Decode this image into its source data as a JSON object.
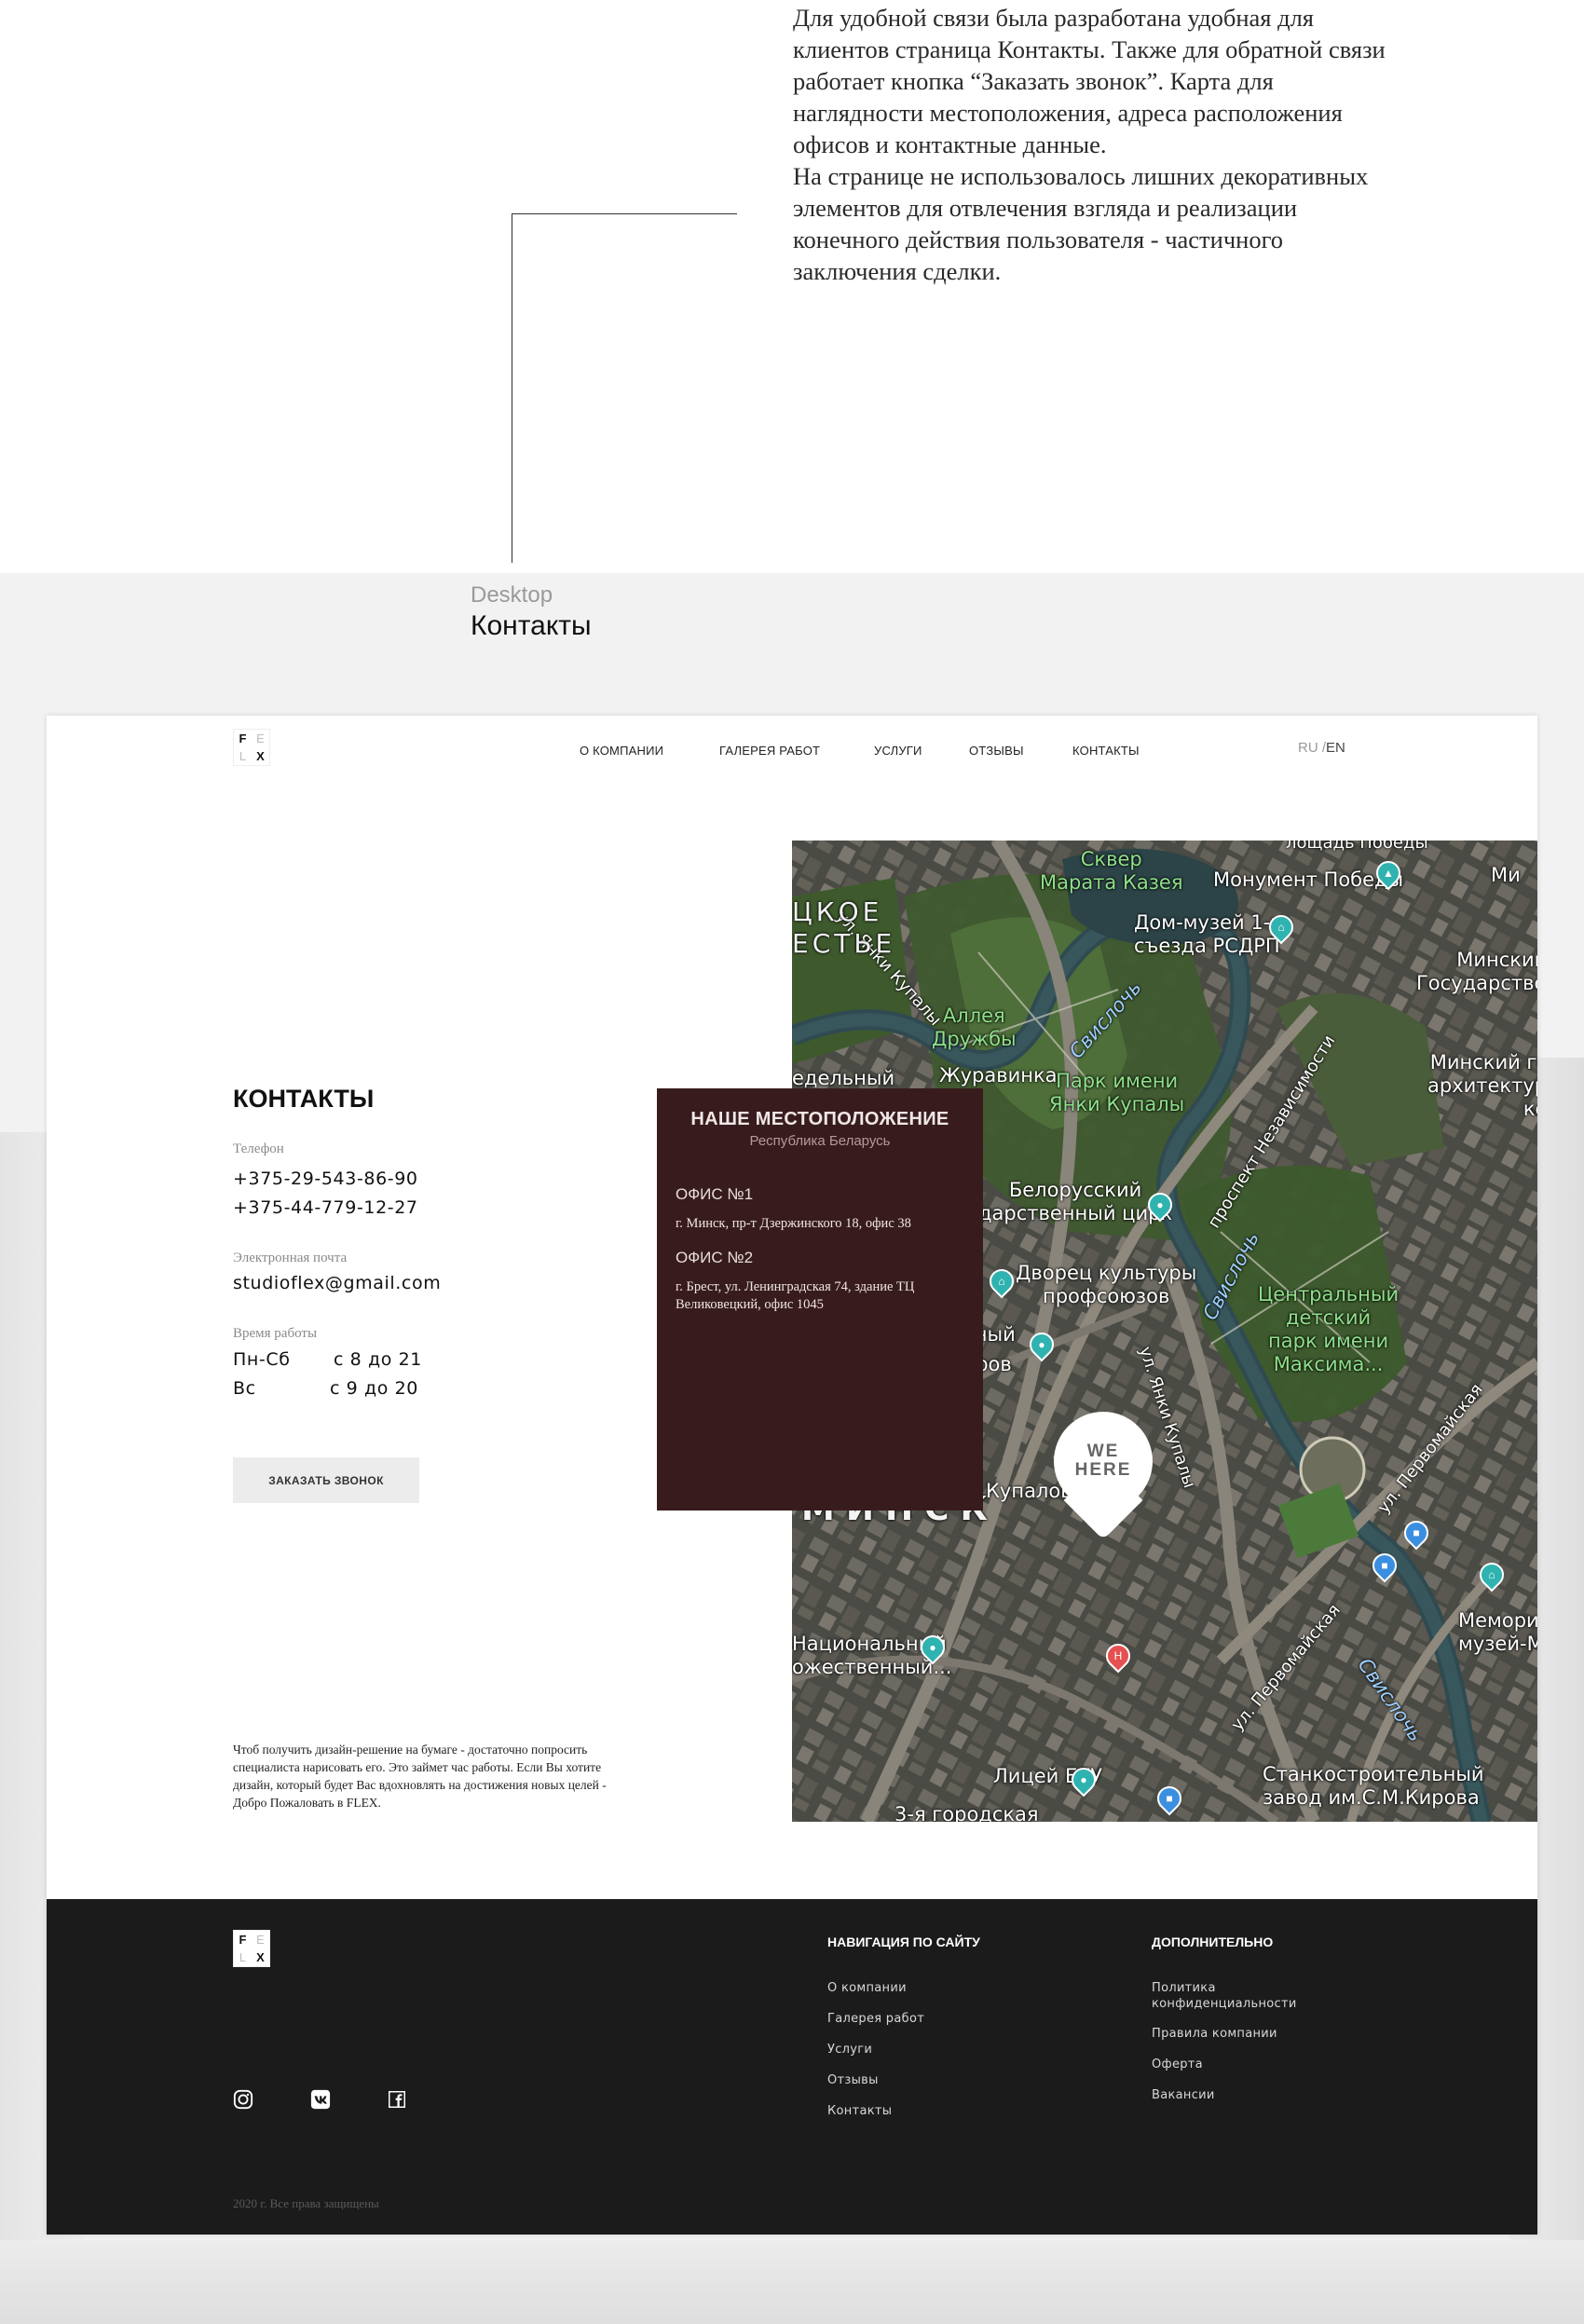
{
  "intro": {
    "paragraph1": "Для удобной связи была разработана удобная для клиентов страница Контакты. Также для обратной связи работает кнопка “Заказать звонок”. Карта для наглядности местоположения, адреса расположения офисов и контактные данные.",
    "paragraph2": "На странице не использовалось лишних декоративных элементов для отвлечения взгляда и реализации конечного действия пользователя - частичного заключения сделки."
  },
  "section": {
    "label": "Desktop",
    "title": "Контакты"
  },
  "logo": {
    "l1": "F",
    "l2": "E",
    "l3": "L",
    "l4": "X"
  },
  "nav": {
    "items": [
      {
        "label": "О КОМПАНИИ"
      },
      {
        "label": "ГАЛЕРЕЯ РАБОТ"
      },
      {
        "label": "УСЛУГИ"
      },
      {
        "label": "ОТЗЫВЫ"
      },
      {
        "label": "КОНТАКТЫ"
      }
    ],
    "lang_ru": "RU",
    "lang_sep": " /",
    "lang_en": "EN"
  },
  "contacts": {
    "title": "КОНТАКТЫ",
    "phone_label": "Телефон",
    "phone1": "+375-29-543-86-90",
    "phone2": "+375-44-779-12-27",
    "email_label": "Электронная почта",
    "email": "studioflex@gmail.com",
    "hours_label": "Время работы",
    "hours": [
      {
        "days": "Пн-Сб",
        "time": "с 8 до 21"
      },
      {
        "days": "Вс",
        "time": "с 9 до 20"
      }
    ],
    "call_button": "ЗАКАЗАТЬ ЗВОНОК",
    "blurb": "Чтоб получить дизайн-решение на бумаге - достаточно попросить специалиста нарисовать его. Это займет час работы. Если Вы хотите дизайн, который будет Вас вдохновлять на достижения новых целей - Добро Пожаловать в FLEX."
  },
  "location": {
    "title": "НАШЕ МЕСТОПОЛОЖЕНИЕ",
    "subtitle": "Республика Беларусь",
    "office1_title": "ОФИС №1",
    "office1_address": "г. Минск, пр-т Дзержинского 18, офис 38",
    "office2_title": "ОФИС №2",
    "office2_address": "г. Брест, ул. Ленинградская 74, здание ТЦ Великовецкий, офис 1045"
  },
  "map": {
    "marker_line1": "WE",
    "marker_line2": "HERE",
    "labels": {
      "skver": "Сквер\nМарата Казея",
      "monument": "Монумент Победы",
      "house": "Дом-музей 1-го\nсъезда РСДРП",
      "minsk_gos": "Минский\nГосударственны",
      "yanki1": "ул. Янки Купалы",
      "svisloch1": "Свислочь",
      "alley": "Аллея\nДружбы",
      "zhuravinka": "Журавинка",
      "park": "Парк имени\nЯнки Купалы",
      "prospekt": "проспект Независимости",
      "arch": "Минский гос\nархитектурн\nкол",
      "belcirk": "Белорусский\nдарственный цирк",
      "dvorets": "Дворец культуры\nпрофсоюзов",
      "svisloch2": "Свислочь",
      "central_park": "Центральный\nдетский\nпарк имени\nМаксима...",
      "yanki2": "ул. Янки Купалы",
      "pervomay1": "ул. Первомайская",
      "minsk": "МИНСК",
      "kupalov": "Купалов",
      "natsional": "Национальный\nожественный...",
      "pervomay2": "ул. Первомайская",
      "svisloch3": "Свислочь",
      "memorial": "Мемориа\nмузей-Мас",
      "litsey": "Лицей БГУ",
      "stanko": "Станкостроительный\nзавод им.С.М.Кирова",
      "gorodskaya": "3-я городская",
      "tskoe": "ЦКОЕ\nЕСТЬЕ",
      "edelny": "едельный",
      "tserov": "церов",
      "nyi": "льный",
      "pobedy": "лощадь Победы",
      "mi": "Ми"
    }
  },
  "footer": {
    "nav_title": "НАВИГАЦИЯ ПО САЙТУ",
    "nav_items": [
      {
        "label": "О компании"
      },
      {
        "label": "Галерея работ"
      },
      {
        "label": "Услуги"
      },
      {
        "label": "Отзывы"
      },
      {
        "label": "Контакты"
      }
    ],
    "extra_title": "ДОПОЛНИТЕЛЬНО",
    "extra_items": [
      {
        "label": "Политика конфиденциальности"
      },
      {
        "label": "Правила компании"
      },
      {
        "label": "Оферта"
      },
      {
        "label": "Вакансии"
      }
    ],
    "social": [
      "instagram-icon",
      "vk-icon",
      "facebook-icon"
    ],
    "copyright": "2020 г. Все права защищены"
  },
  "colors": {
    "location_card": "#381c1d",
    "footer_bg": "#1b1b1b",
    "button_bg": "#ececec",
    "map_green_label": "#8fe08a"
  }
}
